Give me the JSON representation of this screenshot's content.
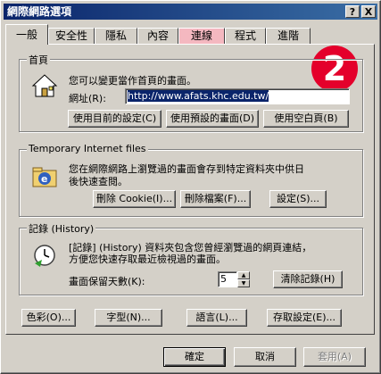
{
  "window": {
    "title": "網際網路選項",
    "help_label": "?",
    "close_label": "X"
  },
  "tabs": [
    {
      "label": "一般",
      "active": true
    },
    {
      "label": "安全性"
    },
    {
      "label": "隱私"
    },
    {
      "label": "內容"
    },
    {
      "label": "連線",
      "highlighted": true
    },
    {
      "label": "程式"
    },
    {
      "label": "進階"
    }
  ],
  "homepage": {
    "legend": "首頁",
    "description": "您可以變更當作首頁的畫面。",
    "address_label": "網址(R):",
    "address_value": "http://www.afats.khc.edu.tw/",
    "btn_current": "使用目前的設定(C)",
    "btn_default": "使用預設的畫面(D)",
    "btn_blank": "使用空白頁(B)"
  },
  "tempfiles": {
    "legend": "Temporary Internet files",
    "description_line1": "您在網際網路上瀏覽過的畫面會存到特定資料夾中供日",
    "description_line2": "後快速查閱。",
    "btn_delete_cookies": "刪除 Cookie(I)...",
    "btn_delete_files": "刪除檔案(F)...",
    "btn_settings": "設定(S)..."
  },
  "history": {
    "legend": "記錄 (History)",
    "description_line1": "[記錄] (History) 資料夾包含您曾經瀏覽過的網頁連結，",
    "description_line2": "方便您快速存取最近檢視過的畫面。",
    "days_label": "畫面保留天數(K):",
    "days_value": "5",
    "btn_clear": "清除記錄(H)"
  },
  "bottom_buttons": {
    "colors": "色彩(O)...",
    "fonts": "字型(N)...",
    "languages": "語言(L)...",
    "accessibility": "存取設定(E)..."
  },
  "dialog_buttons": {
    "ok": "確定",
    "cancel": "取消",
    "apply": "套用(A)"
  },
  "annotation": {
    "badge": "2",
    "badge_color": "#e4002b"
  }
}
